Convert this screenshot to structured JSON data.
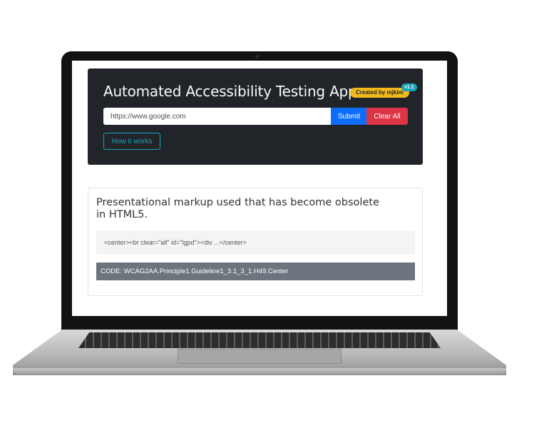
{
  "header": {
    "title": "Automated Accessibility Testing App",
    "creator_badge": "Created by mjkim",
    "version_badge": "v1.1"
  },
  "search": {
    "value": "https://www.google.com",
    "submit_label": "Submit",
    "clear_label": "Clear All",
    "how_label": "How it works"
  },
  "result": {
    "title": "Presentational markup used that has become obsolete in HTML5.",
    "snippet": "<center><br clear=\"all\" id=\"lgpd\"><div ...</center>",
    "code": "CODE: WCAG2AA.Principle1.Guideline1_3.1_3_1.H49.Center"
  },
  "colors": {
    "header_bg": "#212529",
    "submit": "#0d6efd",
    "clear": "#dc3545",
    "info": "#17a2b8",
    "badge": "#f0b81a",
    "code_bar": "#6c757d"
  }
}
